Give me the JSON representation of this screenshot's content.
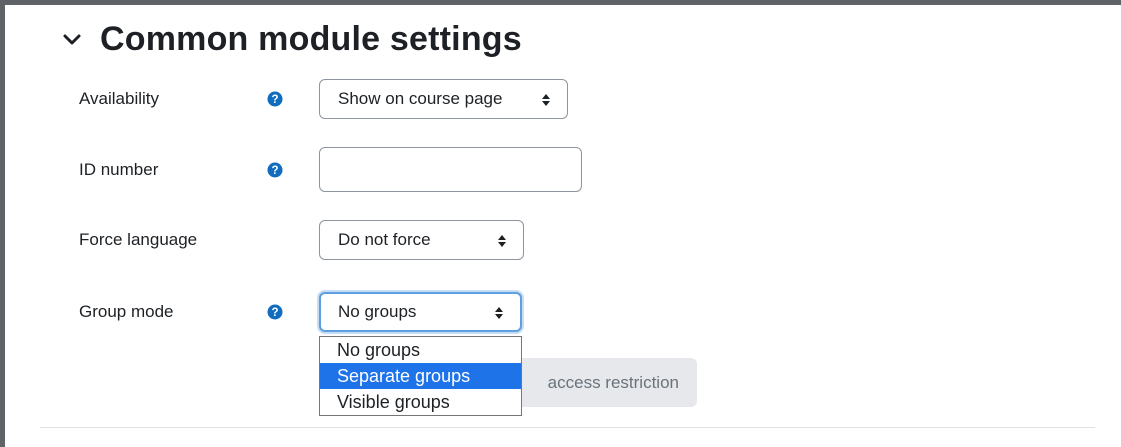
{
  "section": {
    "title": "Common module settings",
    "expand_icon": "chevron-down-icon"
  },
  "fields": {
    "availability": {
      "label": "Availability",
      "value": "Show on course page",
      "help_icon": "question-circle-icon"
    },
    "id_number": {
      "label": "ID number",
      "value": "",
      "help_icon": "question-circle-icon"
    },
    "force_language": {
      "label": "Force language",
      "value": "Do not force"
    },
    "group_mode": {
      "label": "Group mode",
      "value": "No groups",
      "help_icon": "question-circle-icon",
      "options": [
        "No groups",
        "Separate groups",
        "Visible groups"
      ],
      "highlighted_option": "Separate groups"
    }
  },
  "access_restriction_button": {
    "label": "access restriction"
  },
  "colors": {
    "help_icon": "#0f6cbf",
    "focus_ring": "#5f9ee0",
    "dropdown_highlight": "#1e73e8",
    "button_bg": "#e6e8eb"
  }
}
